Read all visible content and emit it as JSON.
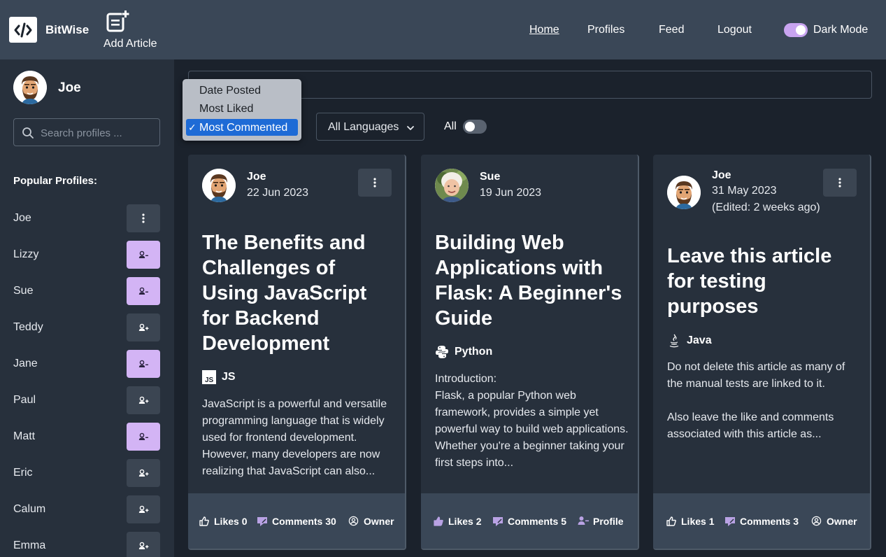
{
  "navbar": {
    "brand": "BitWise",
    "add_article": "Add Article",
    "links": [
      "Home",
      "Profiles",
      "Feed",
      "Logout"
    ],
    "dark_mode_label": "Dark Mode"
  },
  "sidebar": {
    "user_name": "Joe",
    "search_placeholder": "Search profiles ...",
    "popular_title": "Popular Profiles:",
    "profiles": [
      {
        "name": "Joe",
        "action": "menu"
      },
      {
        "name": "Lizzy",
        "action": "unfollow"
      },
      {
        "name": "Sue",
        "action": "unfollow"
      },
      {
        "name": "Teddy",
        "action": "follow"
      },
      {
        "name": "Jane",
        "action": "unfollow"
      },
      {
        "name": "Paul",
        "action": "follow"
      },
      {
        "name": "Matt",
        "action": "unfollow"
      },
      {
        "name": "Eric",
        "action": "follow"
      },
      {
        "name": "Calum",
        "action": "follow"
      },
      {
        "name": "Emma",
        "action": "follow"
      }
    ]
  },
  "filters": {
    "sort_options": [
      "Date Posted",
      "Most Liked",
      "Most Commented"
    ],
    "sort_selected": "Most Commented",
    "language_select": "All Languages",
    "all_toggle_label": "All"
  },
  "articles": [
    {
      "author": "Joe",
      "date": "22 Jun 2023",
      "edited": "",
      "title": "The Benefits and Challenges of Using JavaScript for Backend Development",
      "language": "JS",
      "language_icon": "js-icon",
      "excerpt": "JavaScript is a powerful and versatile programming language that is widely used for frontend development. However, many developers are now realizing that JavaScript can also...",
      "likes": "Likes 0",
      "comments": "Comments 30",
      "third_action": "Owner"
    },
    {
      "author": "Sue",
      "date": "19 Jun 2023",
      "edited": "",
      "title": "Building Web Applications with Flask: A Beginner's Guide",
      "language": "Python",
      "language_icon": "python-icon",
      "excerpt": "Introduction:\nFlask, a popular Python web framework, provides a simple yet powerful way to build web applications. Whether you're a beginner taking your first steps into...",
      "likes": "Likes 2",
      "comments": "Comments 5",
      "third_action": "Profile"
    },
    {
      "author": "Joe",
      "date": "31 May 2023",
      "edited": "(Edited: 2 weeks ago)",
      "title": "Leave this article for testing purposes",
      "language": "Java",
      "language_icon": "java-icon",
      "excerpt": "Do not delete this article as many of the manual tests are linked to it.\n\nAlso leave the like and comments associated with this article as...",
      "likes": "Likes 1",
      "comments": "Comments 3",
      "third_action": "Owner"
    }
  ],
  "colors": {
    "navbar": "#3a4757",
    "background": "#1b222c",
    "card": "#27303c",
    "accent_toggle": "#c8a4f0",
    "unfollow_button": "#d3b4f5",
    "dropdown_selected": "#1e6bd6"
  }
}
